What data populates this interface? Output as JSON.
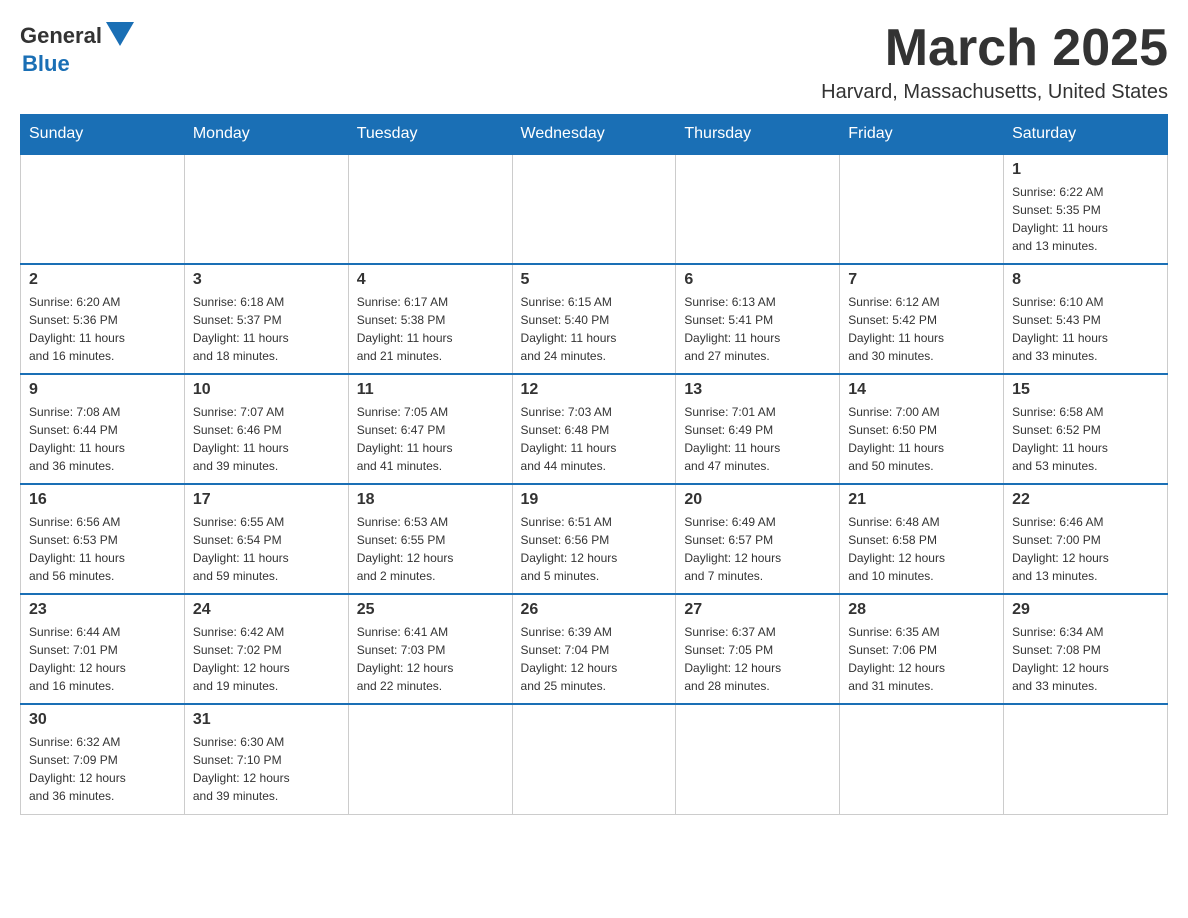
{
  "header": {
    "logo": {
      "general": "General",
      "blue": "Blue"
    },
    "title": "March 2025",
    "subtitle": "Harvard, Massachusetts, United States"
  },
  "weekdays": [
    "Sunday",
    "Monday",
    "Tuesday",
    "Wednesday",
    "Thursday",
    "Friday",
    "Saturday"
  ],
  "weeks": [
    [
      {
        "day": "",
        "info": ""
      },
      {
        "day": "",
        "info": ""
      },
      {
        "day": "",
        "info": ""
      },
      {
        "day": "",
        "info": ""
      },
      {
        "day": "",
        "info": ""
      },
      {
        "day": "",
        "info": ""
      },
      {
        "day": "1",
        "info": "Sunrise: 6:22 AM\nSunset: 5:35 PM\nDaylight: 11 hours\nand 13 minutes."
      }
    ],
    [
      {
        "day": "2",
        "info": "Sunrise: 6:20 AM\nSunset: 5:36 PM\nDaylight: 11 hours\nand 16 minutes."
      },
      {
        "day": "3",
        "info": "Sunrise: 6:18 AM\nSunset: 5:37 PM\nDaylight: 11 hours\nand 18 minutes."
      },
      {
        "day": "4",
        "info": "Sunrise: 6:17 AM\nSunset: 5:38 PM\nDaylight: 11 hours\nand 21 minutes."
      },
      {
        "day": "5",
        "info": "Sunrise: 6:15 AM\nSunset: 5:40 PM\nDaylight: 11 hours\nand 24 minutes."
      },
      {
        "day": "6",
        "info": "Sunrise: 6:13 AM\nSunset: 5:41 PM\nDaylight: 11 hours\nand 27 minutes."
      },
      {
        "day": "7",
        "info": "Sunrise: 6:12 AM\nSunset: 5:42 PM\nDaylight: 11 hours\nand 30 minutes."
      },
      {
        "day": "8",
        "info": "Sunrise: 6:10 AM\nSunset: 5:43 PM\nDaylight: 11 hours\nand 33 minutes."
      }
    ],
    [
      {
        "day": "9",
        "info": "Sunrise: 7:08 AM\nSunset: 6:44 PM\nDaylight: 11 hours\nand 36 minutes."
      },
      {
        "day": "10",
        "info": "Sunrise: 7:07 AM\nSunset: 6:46 PM\nDaylight: 11 hours\nand 39 minutes."
      },
      {
        "day": "11",
        "info": "Sunrise: 7:05 AM\nSunset: 6:47 PM\nDaylight: 11 hours\nand 41 minutes."
      },
      {
        "day": "12",
        "info": "Sunrise: 7:03 AM\nSunset: 6:48 PM\nDaylight: 11 hours\nand 44 minutes."
      },
      {
        "day": "13",
        "info": "Sunrise: 7:01 AM\nSunset: 6:49 PM\nDaylight: 11 hours\nand 47 minutes."
      },
      {
        "day": "14",
        "info": "Sunrise: 7:00 AM\nSunset: 6:50 PM\nDaylight: 11 hours\nand 50 minutes."
      },
      {
        "day": "15",
        "info": "Sunrise: 6:58 AM\nSunset: 6:52 PM\nDaylight: 11 hours\nand 53 minutes."
      }
    ],
    [
      {
        "day": "16",
        "info": "Sunrise: 6:56 AM\nSunset: 6:53 PM\nDaylight: 11 hours\nand 56 minutes."
      },
      {
        "day": "17",
        "info": "Sunrise: 6:55 AM\nSunset: 6:54 PM\nDaylight: 11 hours\nand 59 minutes."
      },
      {
        "day": "18",
        "info": "Sunrise: 6:53 AM\nSunset: 6:55 PM\nDaylight: 12 hours\nand 2 minutes."
      },
      {
        "day": "19",
        "info": "Sunrise: 6:51 AM\nSunset: 6:56 PM\nDaylight: 12 hours\nand 5 minutes."
      },
      {
        "day": "20",
        "info": "Sunrise: 6:49 AM\nSunset: 6:57 PM\nDaylight: 12 hours\nand 7 minutes."
      },
      {
        "day": "21",
        "info": "Sunrise: 6:48 AM\nSunset: 6:58 PM\nDaylight: 12 hours\nand 10 minutes."
      },
      {
        "day": "22",
        "info": "Sunrise: 6:46 AM\nSunset: 7:00 PM\nDaylight: 12 hours\nand 13 minutes."
      }
    ],
    [
      {
        "day": "23",
        "info": "Sunrise: 6:44 AM\nSunset: 7:01 PM\nDaylight: 12 hours\nand 16 minutes."
      },
      {
        "day": "24",
        "info": "Sunrise: 6:42 AM\nSunset: 7:02 PM\nDaylight: 12 hours\nand 19 minutes."
      },
      {
        "day": "25",
        "info": "Sunrise: 6:41 AM\nSunset: 7:03 PM\nDaylight: 12 hours\nand 22 minutes."
      },
      {
        "day": "26",
        "info": "Sunrise: 6:39 AM\nSunset: 7:04 PM\nDaylight: 12 hours\nand 25 minutes."
      },
      {
        "day": "27",
        "info": "Sunrise: 6:37 AM\nSunset: 7:05 PM\nDaylight: 12 hours\nand 28 minutes."
      },
      {
        "day": "28",
        "info": "Sunrise: 6:35 AM\nSunset: 7:06 PM\nDaylight: 12 hours\nand 31 minutes."
      },
      {
        "day": "29",
        "info": "Sunrise: 6:34 AM\nSunset: 7:08 PM\nDaylight: 12 hours\nand 33 minutes."
      }
    ],
    [
      {
        "day": "30",
        "info": "Sunrise: 6:32 AM\nSunset: 7:09 PM\nDaylight: 12 hours\nand 36 minutes."
      },
      {
        "day": "31",
        "info": "Sunrise: 6:30 AM\nSunset: 7:10 PM\nDaylight: 12 hours\nand 39 minutes."
      },
      {
        "day": "",
        "info": ""
      },
      {
        "day": "",
        "info": ""
      },
      {
        "day": "",
        "info": ""
      },
      {
        "day": "",
        "info": ""
      },
      {
        "day": "",
        "info": ""
      }
    ]
  ]
}
